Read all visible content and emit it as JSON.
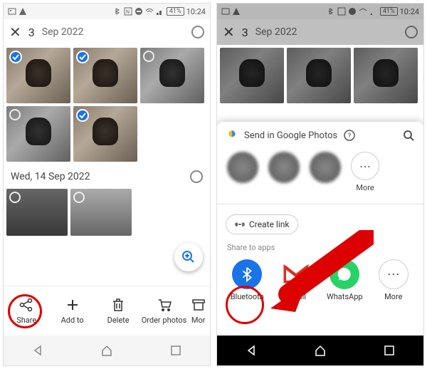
{
  "status": {
    "battery": "41%",
    "time": "10:24"
  },
  "header": {
    "count": "3",
    "date_short": "Sep 2022"
  },
  "date_header": "Wed, 14 Sep 2022",
  "actions": {
    "share": "Share",
    "add": "Add to",
    "delete": "Delete",
    "order": "Order photos",
    "more": "More"
  },
  "sheet": {
    "title": "Send in Google Photos",
    "more": "More",
    "create_link": "Create link",
    "share_to_apps": "Share to apps",
    "apps": {
      "bluetooth": "Bluetooth",
      "gmail": "Gmail",
      "whatsapp": "WhatsApp",
      "more": "More"
    }
  }
}
